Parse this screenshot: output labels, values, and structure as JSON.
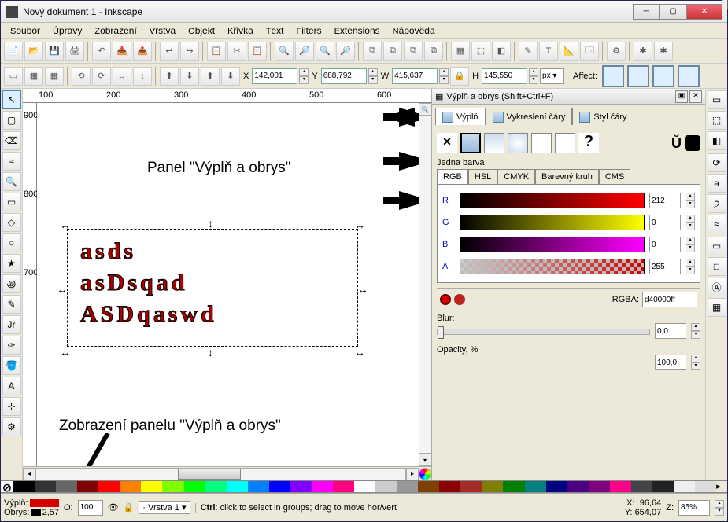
{
  "window": {
    "title": "Nový dokument 1 - Inkscape"
  },
  "menu": [
    "Soubor",
    "Úpravy",
    "Zobrazení",
    "Vrstva",
    "Objekt",
    "Křivka",
    "Text",
    "Filters",
    "Extensions",
    "Nápověda"
  ],
  "toolbarA": [
    "📄",
    "📂",
    "💾",
    "🖨",
    "",
    "↶",
    "📥",
    "📤",
    "",
    "↩",
    "↪",
    "",
    "📋",
    "✂",
    "📋",
    "",
    "🔍",
    "🔎",
    "🔍",
    "🔎",
    "",
    "⧉",
    "⧉",
    "⧉",
    "⧉",
    "",
    "▦",
    "⬚",
    "◧",
    "",
    "✎",
    "T",
    "📐",
    "🗔",
    "",
    "⚙",
    "",
    "✱",
    "✱"
  ],
  "toolbarB_icons": [
    "▭",
    "▦",
    "▦",
    "",
    "⟲",
    "⟳",
    "↔",
    "↕",
    "",
    "⬆",
    "⬇",
    "⬆",
    "⬇"
  ],
  "coords": {
    "x_label": "X",
    "x": "142,001",
    "y_label": "Y",
    "y": "688,792",
    "w_label": "W",
    "w": "415,637",
    "h_label": "H",
    "h": "145,550",
    "unit": "px",
    "affect_label": "Affect:"
  },
  "tools_left": [
    "↖",
    "▢",
    "⌫",
    "≈",
    "🔍",
    "▭",
    "◇",
    "○",
    "★",
    "꩜",
    "✎",
    "Jr",
    "✑",
    "🪣",
    "A",
    "⊹",
    "⚙"
  ],
  "tools_right": [
    "▭",
    "⬚",
    "◧",
    "",
    "⟳",
    "ə",
    "੭",
    "≈",
    "",
    "▭",
    "□",
    "Ⓐ",
    "▦"
  ],
  "ruler_h": [
    "100",
    "200",
    "300",
    "400",
    "500",
    "600"
  ],
  "ruler_v": [
    "900",
    "800",
    "700"
  ],
  "canvas_text": [
    "asds",
    "asDsqad",
    "ASDqaswd"
  ],
  "annotation1": "Panel \"Výplň a obrys\"",
  "annotation2": "Zobrazení panelu \"Výplň a obrys\"",
  "dialog": {
    "title": "Výplň a obrys (Shift+Ctrl+F)",
    "tabs": [
      "Výplň",
      "Vykreslení čáry",
      "Styl čáry"
    ],
    "group_label": "Jedna barva",
    "subtabs": [
      "RGB",
      "HSL",
      "CMYK",
      "Barevný kruh",
      "CMS"
    ],
    "channels": [
      {
        "label": "R",
        "value": "212"
      },
      {
        "label": "G",
        "value": "0"
      },
      {
        "label": "B",
        "value": "0"
      },
      {
        "label": "A",
        "value": "255"
      }
    ],
    "rgba_label": "RGBA:",
    "rgba_value": "d40000ff",
    "blur_label": "Blur:",
    "blur_value": "0,0",
    "opacity_label": "Opacity, %",
    "opacity_value": "100,0"
  },
  "palette_colors": [
    "#000",
    "#333",
    "#666",
    "#800000",
    "#f00",
    "#ff8000",
    "#ff0",
    "#80ff00",
    "#0f0",
    "#00ff80",
    "#0ff",
    "#0080ff",
    "#00f",
    "#8000ff",
    "#f0f",
    "#ff0080",
    "#fff",
    "#ccc",
    "#999",
    "#804000",
    "#8b0000",
    "#a52a2a",
    "#808000",
    "#008000",
    "#008080",
    "#000080",
    "#4b0082",
    "#800080",
    "#f08",
    "#444",
    "#222",
    "#eee",
    "#ddd"
  ],
  "status": {
    "fill_label": "Výplň:",
    "stroke_label": "Obrys:",
    "stroke_w": "2,57",
    "opacity_label": "O:",
    "opacity": "100",
    "layer": "Vrstva 1",
    "hint": "Ctrl: click to select in groups; drag to move hor/vert",
    "x_label": "X:",
    "x": "96,64",
    "y_label": "Y:",
    "y": "654,07",
    "z_label": "Z:",
    "z": "85%"
  }
}
